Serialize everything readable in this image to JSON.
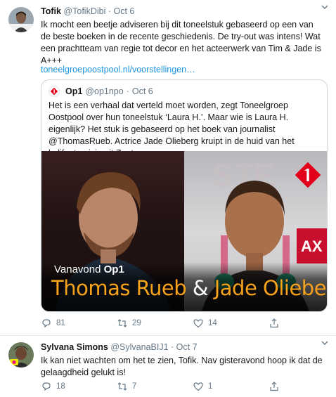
{
  "tweet1": {
    "name": "Tofik",
    "handle": "@TofikDibi",
    "date": "Oct 6",
    "text": "Ik mocht een beetje adviseren bij dit toneelstuk gebaseerd op een van de beste boeken in de recente geschiedenis. De try-out was intens! Wat een prachtteam van regie tot decor en het acteerwerk van Tim & Jade is A+++",
    "link": "toneelgroepoostpool.nl/voorstellingen…",
    "quote": {
      "name": "Op1",
      "handle": "@op1npo",
      "date": "Oct 6",
      "text": "Het is een verhaal dat verteld moet worden, zegt Toneelgroep Oostpool over hun toneelstuk ‘Laura H.’. Maar wie is Laura H. eigenlijk? Het stuk is gebaseerd op het boek van journalist @ThomasRueb. Actrice Jade Olieberg kruipt in de huid van het kalifaatmeisje uit Zoetermeer.",
      "image": {
        "vanavond": "Vanavond",
        "brand": "Op1",
        "name_left": "Thomas Rueb",
        "amp": "&",
        "name_right": "Jade Olieberg"
      }
    },
    "replies": "81",
    "retweets": "29",
    "likes": "14"
  },
  "tweet2": {
    "name": "Sylvana Simons",
    "handle": "@SylvanaBIJ1",
    "date": "Oct 7",
    "text": "Ik kan niet wachten om het te zien, Tofik. Nav gisteravond hoop ik dat de gelaagdheid gelukt is!",
    "replies": "18",
    "retweets": "7",
    "likes": "1"
  },
  "icons": {
    "reply": "reply-icon",
    "retweet": "retweet-icon",
    "like": "heart-icon",
    "share": "share-icon",
    "caret": "chevron-down-icon"
  },
  "colors": {
    "link": "#1b95e0",
    "secondary": "#657786",
    "accent_orange": "#f7a21b",
    "op1_red": "#e3001b"
  }
}
